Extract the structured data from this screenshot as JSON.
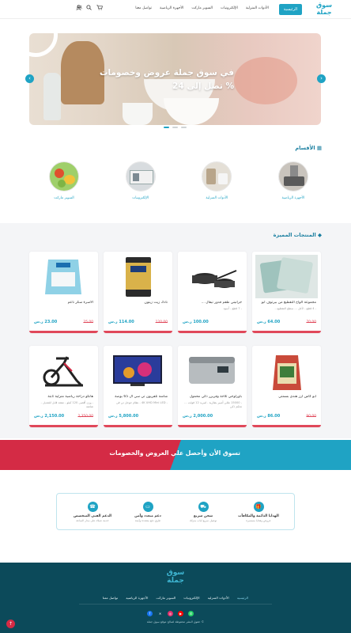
{
  "header": {
    "logo_line1": "سوق",
    "logo_line2": "جملة",
    "active_item": "الرئيسية",
    "nav_items": [
      "الأدوات المنزلية",
      "الإلكترونيات",
      "السوبر ماركت",
      "الأجهزة الرياضية",
      "تواصل معنا"
    ],
    "lang": "AR",
    "cart_icon": "cart-icon",
    "search_icon": "search-icon",
    "user_icon": "user-icon"
  },
  "hero": {
    "line1": "في سوق جملة عروض وخصومات",
    "line2": "تصل إلى 24 %",
    "prev": "‹",
    "next": "›"
  },
  "categories_section": {
    "title": "الأقسام",
    "items": [
      {
        "label": "الأجهزة الرياضية"
      },
      {
        "label": "الأدوات المنزلية"
      },
      {
        "label": "الإلكترونيات"
      },
      {
        "label": "السوبر ماركت"
      }
    ]
  },
  "products_section": {
    "title": "المنتجات المميزة",
    "currency": "ر.س",
    "products": [
      {
        "name": "مجموعة ألواح التقطيع من بيرتوف أبو",
        "desc": "- 4 قطع - لأجل ... سطح التقطيع...",
        "price": "64.00 ر.س",
        "old_price": "70.00"
      },
      {
        "name": "جرانيتي طقم قدور تيفال ...",
        "desc": "- 7 قطع - أسود",
        "price": "100.00 ر.س",
        "old_price": ""
      },
      {
        "name": "نادك زيت زيتون",
        "desc": "",
        "price": "114.00 ر.س",
        "old_price": "120.00"
      },
      {
        "name": "الأسرة سكر ناعم",
        "desc": "",
        "price": "23.00 ر.س",
        "old_price": "25.00"
      },
      {
        "name": "أبو كاس أرز هندي بسمتي",
        "desc": "",
        "price": "86.00 ر.س",
        "old_price": "90.00"
      },
      {
        "name": "باورلوجي ثلاجة وفريزر ذكي محمول",
        "desc": "- 15000 مللي أمبير بطارية - لتبريد 12 فولت ... تحكم ذكي",
        "price": "2,000.00 ر.س",
        "old_price": ""
      },
      {
        "name": "شاشة تلفزيون تي سي ال 65 بوصة",
        "desc": "- 4K UHD Mini LED - نظام جوجل تي في",
        "price": "5,800.00 ر.س",
        "old_price": ""
      },
      {
        "name": "هانكو دراجة رياضية منزلية ثابتة",
        "desc": "- وزن أقصى 120 كيلو - مقعد قابل للتعديل - شاشة",
        "price": "2,150.00 ر.س",
        "old_price": "2,350.00"
      }
    ]
  },
  "banner": {
    "text": "تسوق الأن وأحصل علي العروض والخصومات"
  },
  "features": [
    {
      "title": "الهدايا الدائمة والمكافآت",
      "desc": "عروض وهدايا مستمرة",
      "icon": "gift-icon"
    },
    {
      "title": "شحن سريع",
      "desc": "توصيل سريع لباب منزلك",
      "icon": "truck-icon"
    },
    {
      "title": "دعم متعدد وآمن",
      "desc": "طرق دفع متعددة وآمنة",
      "icon": "card-icon"
    },
    {
      "title": "الدعم الفني المتخصص",
      "desc": "خدمة عملاء على مدار الساعة",
      "icon": "headset-icon"
    }
  ],
  "footer": {
    "logo_line1": "سوق",
    "logo_line2": "جملة",
    "links": [
      "الرئيسية",
      "الأدوات المنزلية",
      "الإلكترونيات",
      "السوبر ماركت",
      "الأجهزة الرياضية",
      "تواصل معنا"
    ],
    "social": [
      "whatsapp-icon",
      "instagram-icon",
      "youtube-icon",
      "x-icon",
      "facebook-icon"
    ],
    "copyright": "حقوق النشر محفوظة لصالح موقع سوق جملة ©"
  },
  "colors": {
    "primary": "#1fa3c4",
    "accent": "#d42b45",
    "footer_bg": "#0c4a5a"
  }
}
